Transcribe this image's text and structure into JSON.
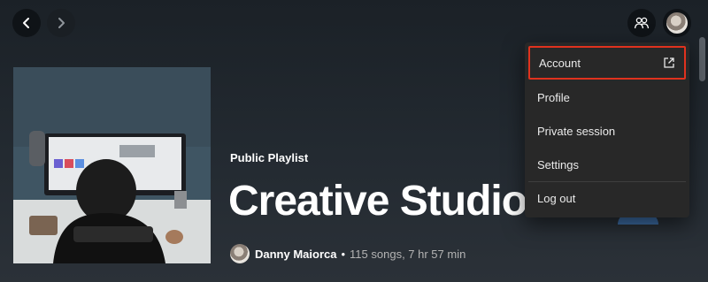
{
  "topbar": {
    "back_icon": "chevron-left-icon",
    "forward_icon": "chevron-right-icon",
    "friends_icon": "friend-activity-icon",
    "avatar_icon": "user-avatar"
  },
  "playlist": {
    "type": "Public Playlist",
    "title": "Creative Studio V",
    "owner": "Danny Maiorca",
    "separator": "•",
    "stats": "115 songs, 7 hr 57 min"
  },
  "menu": {
    "items": [
      {
        "label": "Account",
        "icon": "external-link-icon",
        "highlighted": true
      },
      {
        "label": "Profile"
      },
      {
        "label": "Private session"
      },
      {
        "label": "Settings"
      },
      {
        "label": "Log out"
      }
    ]
  },
  "colors": {
    "highlight_border": "#e0321e",
    "menu_bg": "#282828"
  }
}
